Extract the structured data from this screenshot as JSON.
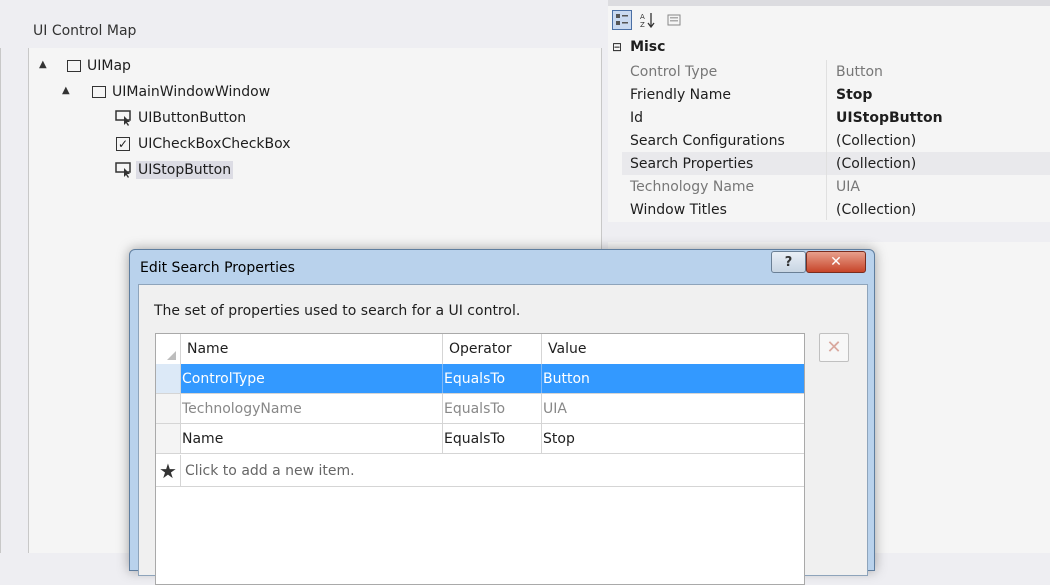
{
  "left_pane": {
    "title": "UI Control Map",
    "tree": [
      {
        "label": "UIMap",
        "icon": "window-icon",
        "level": 0,
        "expander": "▲"
      },
      {
        "label": "UIMainWindowWindow",
        "icon": "window-icon",
        "level": 1,
        "expander": "▲"
      },
      {
        "label": "UIButtonButton",
        "icon": "button-cursor-icon",
        "level": 2
      },
      {
        "label": "UICheckBoxCheckBox",
        "icon": "checkbox-icon",
        "level": 2
      },
      {
        "label": "UIStopButton",
        "icon": "button-cursor-icon",
        "level": 2,
        "selected": true
      }
    ]
  },
  "properties": {
    "category": "Misc",
    "rows": [
      {
        "name": "Control Type",
        "value": "Button",
        "dim": true
      },
      {
        "name": "Friendly Name",
        "value": "Stop",
        "bold": true
      },
      {
        "name": "Id",
        "value": "UIStopButton",
        "bold": true
      },
      {
        "name": "Search Configurations",
        "value": "(Collection)"
      },
      {
        "name": "Search Properties",
        "value": "(Collection)"
      },
      {
        "name": "Technology Name",
        "value": "UIA",
        "dim": true
      },
      {
        "name": "Window Titles",
        "value": "(Collection)"
      }
    ]
  },
  "dialog": {
    "title": "Edit Search Properties",
    "help_label": "?",
    "close_label": "✕",
    "description": "The set of properties used to search for a UI control.",
    "columns": [
      "Name",
      "Operator",
      "Value"
    ],
    "rows": [
      {
        "name": "ControlType",
        "operator": "EqualsTo",
        "value": "Button",
        "selected": true
      },
      {
        "name": "TechnologyName",
        "operator": "EqualsTo",
        "value": "UIA",
        "dim": true
      },
      {
        "name": "Name",
        "operator": "EqualsTo",
        "value": "Stop"
      }
    ],
    "new_item_text": "Click to add a new item.",
    "new_item_icon": "★"
  },
  "colors": {
    "selection": "#3399ff",
    "dialog_frame": "#b9d2ec",
    "close_button": "#c7452a"
  }
}
